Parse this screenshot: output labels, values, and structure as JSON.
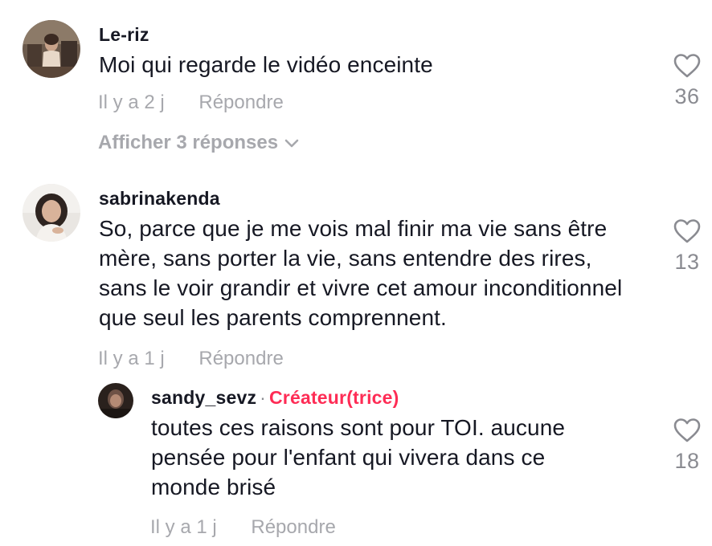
{
  "comments": [
    {
      "username": "Le-riz",
      "text": "Moi qui regarde le vidéo enceinte",
      "time": "Il y a 2 j",
      "reply_label": "Répondre",
      "likes": "36",
      "show_replies": "Afficher 3 réponses"
    },
    {
      "username": "sabrinakenda",
      "text": "So, parce que je me vois mal finir ma vie sans être mère, sans porter la vie, sans entendre des rires, sans le voir grandir et vivre cet amour inconditionnel que seul les parents comprennent.",
      "time": "Il y a 1 j",
      "reply_label": "Répondre",
      "likes": "13"
    },
    {
      "username": "sandy_sevz",
      "separator": "·",
      "badge": "Créateur(trice)",
      "text": "toutes ces raisons sont pour TOI. aucune pensée pour l'enfant qui vivera dans ce monde brisé",
      "time": "Il y a 1 j",
      "reply_label": "Répondre",
      "likes": "18"
    }
  ],
  "icons": {
    "like": "heart-outline-icon",
    "expand": "chevron-down-icon"
  },
  "colors": {
    "text": "#161823",
    "muted": "#a7a8ad",
    "count": "#8a8b91",
    "creator_badge": "#fe2c55"
  }
}
